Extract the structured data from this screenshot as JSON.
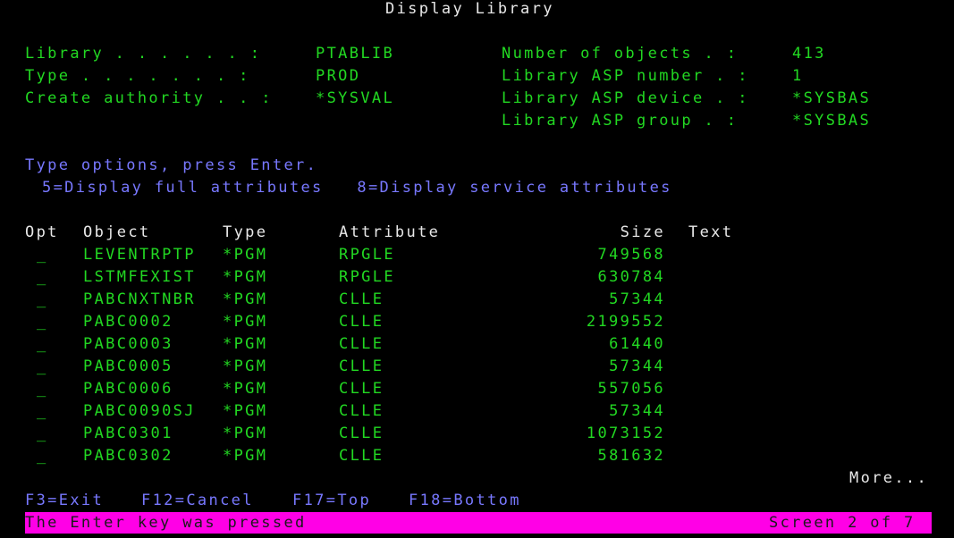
{
  "title": "Display Library",
  "library": {
    "library_label": "Library . . . . . . :",
    "library_value": "PTABLIB",
    "type_label": "Type . . . . . . . :",
    "type_value": "PROD",
    "create_auth_label": "Create authority . . :",
    "create_auth_value": "*SYSVAL",
    "num_objects_label": "Number of objects . :",
    "num_objects_value": "413",
    "asp_number_label": "Library ASP number . :",
    "asp_number_value": "1",
    "asp_device_label": "Library ASP device . :",
    "asp_device_value": "*SYSBAS",
    "asp_group_label": "Library ASP group . :",
    "asp_group_value": "*SYSBAS"
  },
  "instructions": {
    "line1": "Type options, press Enter.",
    "line2": "5=Display full attributes   8=Display service attributes"
  },
  "table": {
    "headers": {
      "opt": "Opt",
      "object": "Object",
      "type": "Type",
      "attribute": "Attribute",
      "size": "Size",
      "text": "Text"
    },
    "rows": [
      {
        "opt": "_",
        "object": "LEVENTRPTP",
        "type": "*PGM",
        "attribute": "RPGLE",
        "size": "749568",
        "text": ""
      },
      {
        "opt": "_",
        "object": "LSTMFEXIST",
        "type": "*PGM",
        "attribute": "RPGLE",
        "size": "630784",
        "text": ""
      },
      {
        "opt": "_",
        "object": "PABCNXTNBR",
        "type": "*PGM",
        "attribute": "CLLE",
        "size": "57344",
        "text": ""
      },
      {
        "opt": "_",
        "object": "PABC0002",
        "type": "*PGM",
        "attribute": "CLLE",
        "size": "2199552",
        "text": ""
      },
      {
        "opt": "_",
        "object": "PABC0003",
        "type": "*PGM",
        "attribute": "CLLE",
        "size": "61440",
        "text": ""
      },
      {
        "opt": "_",
        "object": "PABC0005",
        "type": "*PGM",
        "attribute": "CLLE",
        "size": "57344",
        "text": ""
      },
      {
        "opt": "_",
        "object": "PABC0006",
        "type": "*PGM",
        "attribute": "CLLE",
        "size": "557056",
        "text": ""
      },
      {
        "opt": "_",
        "object": "PABC0090SJ",
        "type": "*PGM",
        "attribute": "CLLE",
        "size": "57344",
        "text": ""
      },
      {
        "opt": "_",
        "object": "PABC0301",
        "type": "*PGM",
        "attribute": "CLLE",
        "size": "1073152",
        "text": ""
      },
      {
        "opt": "_",
        "object": "PABC0302",
        "type": "*PGM",
        "attribute": "CLLE",
        "size": "581632",
        "text": ""
      }
    ]
  },
  "more": "More...",
  "function_keys": {
    "f3": "F3=Exit",
    "f12": "F12=Cancel",
    "f17": "F17=Top",
    "f18": "F18=Bottom"
  },
  "status": {
    "message": "The Enter key was pressed",
    "screen": "Screen 2 of 7"
  },
  "colors": {
    "background": "#000000",
    "field_green": "#22d822",
    "instruction_blue": "#7878ff",
    "title_white": "#e8e8e8",
    "status_bar": "#ff00e6"
  }
}
